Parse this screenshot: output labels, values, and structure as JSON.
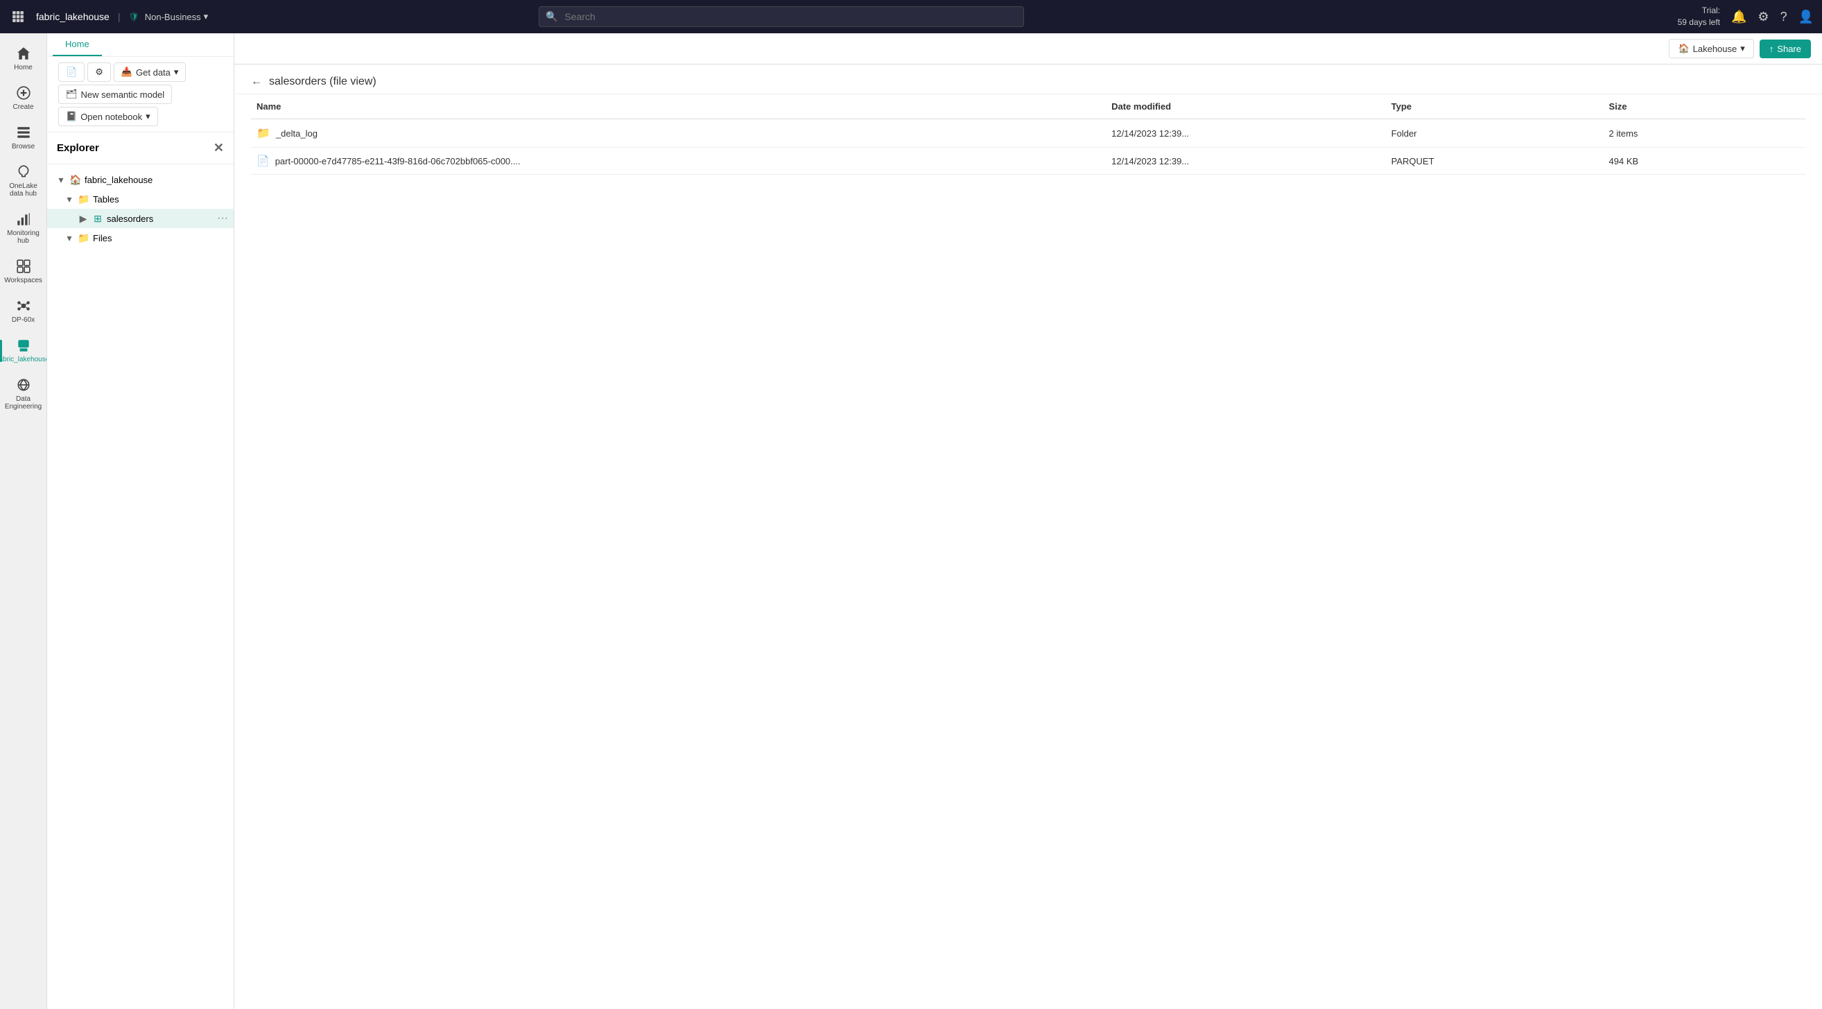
{
  "topbar": {
    "brand_name": "fabric_lakehouse",
    "sensitivity": "Non-Business",
    "search_placeholder": "Search",
    "trial_line1": "Trial:",
    "trial_line2": "59 days left"
  },
  "toolbar": {
    "home_tab": "Home",
    "new_item_label": "",
    "settings_label": "",
    "get_data_label": "Get data",
    "new_semantic_label": "New semantic model",
    "open_notebook_label": "Open notebook",
    "lakehouse_label": "Lakehouse",
    "share_label": "Share"
  },
  "explorer": {
    "title": "Explorer",
    "root": "fabric_lakehouse",
    "tables_label": "Tables",
    "salesorders_label": "salesorders",
    "files_label": "Files"
  },
  "page": {
    "title": "salesorders (file view)",
    "columns": {
      "name": "Name",
      "date_modified": "Date modified",
      "type": "Type",
      "size": "Size"
    },
    "rows": [
      {
        "name": "_delta_log",
        "date_modified": "12/14/2023 12:39...",
        "type": "Folder",
        "size": "2 items",
        "icon": "folder"
      },
      {
        "name": "part-00000-e7d47785-e211-43f9-816d-06c702bbf065-c000....",
        "date_modified": "12/14/2023 12:39...",
        "type": "PARQUET",
        "size": "494 KB",
        "icon": "file"
      }
    ]
  },
  "sidebar_icons": [
    {
      "id": "home",
      "label": "Home",
      "active": false
    },
    {
      "id": "create",
      "label": "Create",
      "active": false
    },
    {
      "id": "browse",
      "label": "Browse",
      "active": false
    },
    {
      "id": "onelake",
      "label": "OneLake data hub",
      "active": false
    },
    {
      "id": "monitoring",
      "label": "Monitoring hub",
      "active": false
    },
    {
      "id": "workspaces",
      "label": "Workspaces",
      "active": false
    },
    {
      "id": "dp60x",
      "label": "DP-60x",
      "active": false
    },
    {
      "id": "fabric_lakehouse",
      "label": "fabric_lakehouse",
      "active": true
    },
    {
      "id": "data_engineering",
      "label": "Data Engineering",
      "active": false
    }
  ]
}
